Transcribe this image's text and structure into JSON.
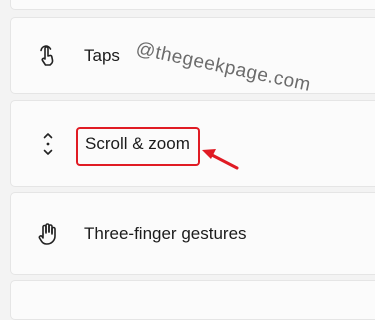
{
  "settings": {
    "items": [
      {
        "label": "Taps",
        "icon": "tap-icon"
      },
      {
        "label": "Scroll & zoom",
        "icon": "scroll-zoom-icon"
      },
      {
        "label": "Three-finger gestures",
        "icon": "hand-gesture-icon"
      }
    ]
  },
  "watermark": "@thegeekpage.com",
  "annotation": {
    "color": "#e01b24"
  }
}
